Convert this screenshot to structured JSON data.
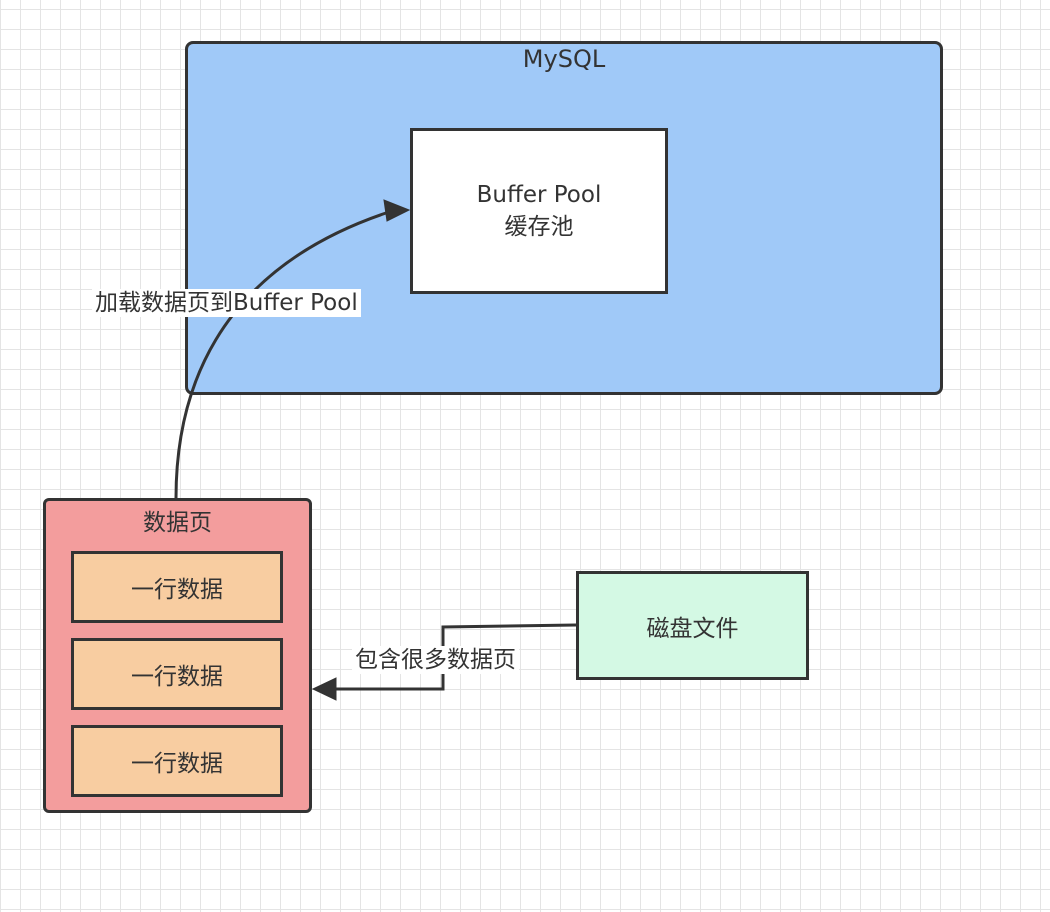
{
  "diagram": {
    "mysql": {
      "title": "MySQL"
    },
    "buffer_pool": {
      "line1": "Buffer Pool",
      "line2": "缓存池"
    },
    "data_page": {
      "title": "数据页",
      "rows": [
        "一行数据",
        "一行数据",
        "一行数据"
      ]
    },
    "disk_file": {
      "label": "磁盘文件"
    },
    "edges": {
      "load": "加载数据页到Buffer Pool",
      "contains": "包含很多数据页"
    },
    "colors": {
      "mysql_fill": "#a0c9f8",
      "buffer_fill": "#ffffff",
      "page_fill": "#f39d9d",
      "row_fill": "#f8cda1",
      "disk_fill": "#d4f9e4",
      "stroke": "#333333"
    }
  }
}
